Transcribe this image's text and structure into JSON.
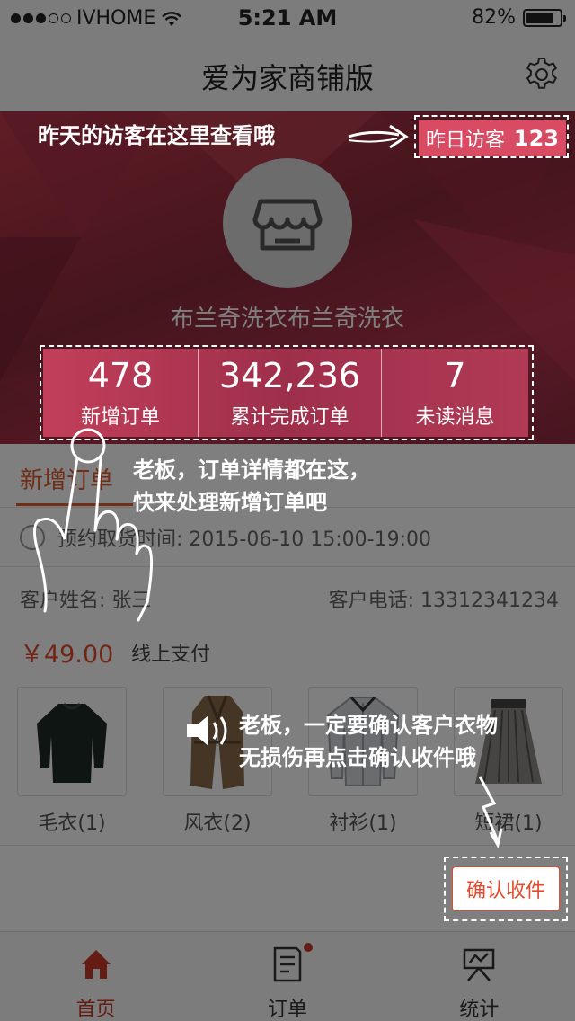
{
  "status_bar": {
    "carrier": "IVHOME",
    "time": "5:21 AM",
    "battery": "82%",
    "battery_level": 0.82
  },
  "nav": {
    "title": "爱为家商铺版",
    "settings_icon": "gear-icon"
  },
  "store": {
    "name": "布兰奇洗衣布兰奇洗衣",
    "icon": "store-icon"
  },
  "visitors": {
    "label": "昨日访客",
    "count": "123"
  },
  "stats": [
    {
      "value": "478",
      "label": "新增订单"
    },
    {
      "value": "342,236",
      "label": "累计完成订单"
    },
    {
      "value": "7",
      "label": "未读消息"
    }
  ],
  "order": {
    "tab_label": "新增订单",
    "pickup_time": "预约取货时间: 2015-06-10 15:00-19:00",
    "customer_name": "客户姓名: 张三",
    "customer_phone": "客户电话: 13312341234",
    "price": "￥49.00",
    "payment": "线上支付",
    "items": [
      {
        "name": "毛衣(1)",
        "icon": "sweater-icon"
      },
      {
        "name": "风衣(2)",
        "icon": "trench-coat-icon"
      },
      {
        "name": "衬衫(1)",
        "icon": "shirt-icon"
      },
      {
        "name": "短裙(1)",
        "icon": "skirt-icon"
      }
    ],
    "confirm_label": "确认收件"
  },
  "tabbar": {
    "items": [
      {
        "label": "首页",
        "icon": "home-icon",
        "active": true
      },
      {
        "label": "订单",
        "icon": "orders-icon",
        "active": false
      },
      {
        "label": "统计",
        "icon": "stats-icon",
        "active": false
      }
    ]
  },
  "guide": {
    "tip_visitors": "昨天的访客在这里查看哦",
    "tip_orders_line1": "老板，订单详情都在这，",
    "tip_orders_line2": "快来处理新增订单吧",
    "tip_confirm_line1": "老板，一定要确认客户衣物",
    "tip_confirm_line2": "无损伤再点击确认收件哦"
  },
  "colors": {
    "accent": "#e24b2b",
    "hero": "#b0344a",
    "tab_active": "#c9392a"
  }
}
